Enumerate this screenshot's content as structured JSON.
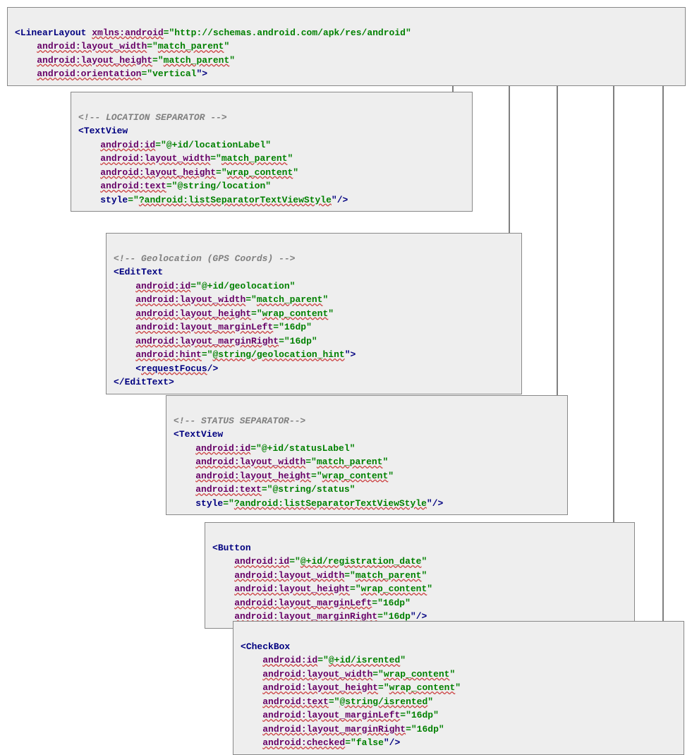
{
  "box1": {
    "line1": {
      "open": "<",
      "tag": "LinearLayout",
      "sp": " ",
      "ns": "xmlns:android",
      "eq": "=\"",
      "val": "http://schemas.android.com/apk/res/android",
      "close": "\""
    },
    "line2": {
      "indent": "    ",
      "attr": "android:layout_width",
      "eq": "=\"",
      "val": "match_parent",
      "close": "\""
    },
    "line3": {
      "indent": "    ",
      "attr": "android:layout_height",
      "eq": "=\"",
      "val": "match_parent",
      "close": "\""
    },
    "line4": {
      "indent": "    ",
      "attr": "android:orientation",
      "eq": "=\"",
      "val": "vertical",
      "close": "\">"
    }
  },
  "box2": {
    "comment": "<!-- LOCATION SEPARATOR -->",
    "tagline": {
      "open": "<",
      "tag": "TextView"
    },
    "l1": {
      "indent": "    ",
      "attr": "android:id",
      "eq": "=\"",
      "val": "@+id/locationLabel",
      "close": "\""
    },
    "l2": {
      "indent": "    ",
      "attr": "android:layout_width",
      "eq": "=\"",
      "val": "match_parent",
      "close": "\""
    },
    "l3": {
      "indent": "    ",
      "attr": "android:layout_height",
      "eq": "=\"",
      "val": "wrap_content",
      "close": "\""
    },
    "l4": {
      "indent": "    ",
      "attr": "android:text",
      "eq": "=\"",
      "val": "@string/location",
      "close": "\""
    },
    "l5": {
      "indent": "    ",
      "attrplain": "style",
      "eq": "=\"",
      "val": "?android:listSeparatorTextViewStyle",
      "close": "\"/>"
    }
  },
  "box3": {
    "comment": "<!-- Geolocation (GPS Coords) -->",
    "tagline": {
      "open": "<",
      "tag": "EditText"
    },
    "l1": {
      "indent": "    ",
      "attr": "android:id",
      "eq": "=\"",
      "val": "@+id/geolocation",
      "close": "\""
    },
    "l2": {
      "indent": "    ",
      "attr": "android:layout_width",
      "eq": "=\"",
      "val": "match_parent",
      "close": "\""
    },
    "l3": {
      "indent": "    ",
      "attr": "android:layout_height",
      "eq": "=\"",
      "val": "wrap_content",
      "close": "\""
    },
    "l4": {
      "indent": "    ",
      "attr": "android:layout_marginLeft",
      "eq": "=\"",
      "val": "16dp",
      "close": "\""
    },
    "l5": {
      "indent": "    ",
      "attr": "android:layout_marginRight",
      "eq": "=\"",
      "val": "16dp",
      "close": "\""
    },
    "l6": {
      "indent": "    ",
      "attr": "android:hint",
      "eq": "=\"",
      "val": "@string/geolocation_hint",
      "close": "\">"
    },
    "l7": {
      "indent": "    ",
      "open": "<",
      "tag": "requestFocus",
      "close": "/>"
    },
    "closing": {
      "open": "</",
      "tag": "EditText",
      "close": ">"
    }
  },
  "box4": {
    "comment": "<!-- STATUS SEPARATOR-->",
    "tagline": {
      "open": "<",
      "tag": "TextView"
    },
    "l1": {
      "indent": "    ",
      "attr": "android:id",
      "eq": "=\"",
      "val": "@+id/statusLabel",
      "close": "\""
    },
    "l2": {
      "indent": "    ",
      "attr": "android:layout_width",
      "eq": "=\"",
      "val": "match_parent",
      "close": "\""
    },
    "l3": {
      "indent": "    ",
      "attr": "android:layout_height",
      "eq": "=\"",
      "val": "wrap_content",
      "close": "\""
    },
    "l4": {
      "indent": "    ",
      "attr": "android:text",
      "eq": "=\"",
      "val": "@string/status",
      "close": "\""
    },
    "l5": {
      "indent": "    ",
      "attrplain": "style",
      "eq": "=\"",
      "val": "?android:listSeparatorTextViewStyle",
      "close": "\"/>"
    }
  },
  "box5": {
    "tagline": {
      "open": "<",
      "tag": "Button"
    },
    "l1": {
      "indent": "    ",
      "attr": "android:id",
      "eq": "=\"",
      "val": "@+id/registration_date",
      "close": "\""
    },
    "l2": {
      "indent": "    ",
      "attr": "android:layout_width",
      "eq": "=\"",
      "val": "match_parent",
      "close": "\""
    },
    "l3": {
      "indent": "    ",
      "attr": "android:layout_height",
      "eq": "=\"",
      "val": "wrap_content",
      "close": "\""
    },
    "l4": {
      "indent": "    ",
      "attr": "android:layout_marginLeft",
      "eq": "=\"",
      "val": "16dp",
      "close": "\""
    },
    "l5": {
      "indent": "    ",
      "attr": "android:layout_marginRight",
      "eq": "=\"",
      "val": "16dp",
      "close": "\"/>"
    }
  },
  "box6": {
    "tagline": {
      "open": "<",
      "tag": "CheckBox"
    },
    "l1": {
      "indent": "    ",
      "attr": "android:id",
      "eq": "=\"",
      "val": "@+id/isrented",
      "close": "\""
    },
    "l2": {
      "indent": "    ",
      "attr": "android:layout_width",
      "eq": "=\"",
      "val": "wrap_content",
      "close": "\""
    },
    "l3": {
      "indent": "    ",
      "attr": "android:layout_height",
      "eq": "=\"",
      "val": "wrap_content",
      "close": "\""
    },
    "l4": {
      "indent": "    ",
      "attr": "android:text",
      "eq": "=\"",
      "val": "@string/isrented",
      "close": "\""
    },
    "l5": {
      "indent": "    ",
      "attr": "android:layout_marginLeft",
      "eq": "=\"",
      "val": "16dp",
      "close": "\""
    },
    "l6": {
      "indent": "    ",
      "attr": "android:layout_marginRight",
      "eq": "=\"",
      "val": "16dp",
      "close": "\""
    },
    "l7": {
      "indent": "    ",
      "attr": "android:checked",
      "eq": "=\"",
      "val": "false",
      "close": "\"/>"
    }
  }
}
